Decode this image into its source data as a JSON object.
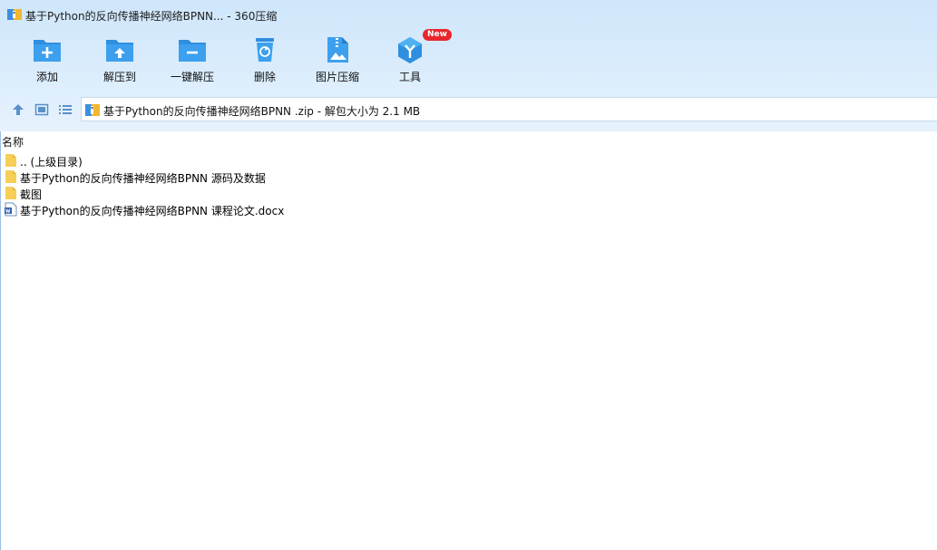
{
  "window": {
    "title": "基于Python的反向传播神经网络BPNN... - 360压缩"
  },
  "toolbar": {
    "items": [
      {
        "label": "添加",
        "icon": "add-folder-icon"
      },
      {
        "label": "解压到",
        "icon": "extract-to-icon"
      },
      {
        "label": "一键解压",
        "icon": "one-click-extract-icon"
      },
      {
        "label": "删除",
        "icon": "trash-icon"
      },
      {
        "label": "图片压缩",
        "icon": "image-compress-icon"
      },
      {
        "label": "工具",
        "icon": "tools-icon",
        "badge": "New"
      }
    ]
  },
  "navbar": {
    "buttons": [
      "up-arrow-icon",
      "view-thumbnail-icon",
      "view-list-icon"
    ],
    "address": "基于Python的反向传播神经网络BPNN .zip - 解包大小为 2.1 MB"
  },
  "file_list": {
    "header": "名称",
    "items": [
      {
        "name": ".. (上级目录)",
        "icon": "folder-icon"
      },
      {
        "name": "基于Python的反向传播神经网络BPNN 源码及数据",
        "icon": "folder-icon"
      },
      {
        "name": "截图",
        "icon": "folder-icon"
      },
      {
        "name": "基于Python的反向传播神经网络BPNN 课程论文.docx",
        "icon": "word-doc-icon"
      }
    ]
  },
  "colors": {
    "accent": "#2f8ee0",
    "header_bg": "#d6eafb",
    "badge": "#e8262e",
    "folder": "#f6cf57"
  }
}
